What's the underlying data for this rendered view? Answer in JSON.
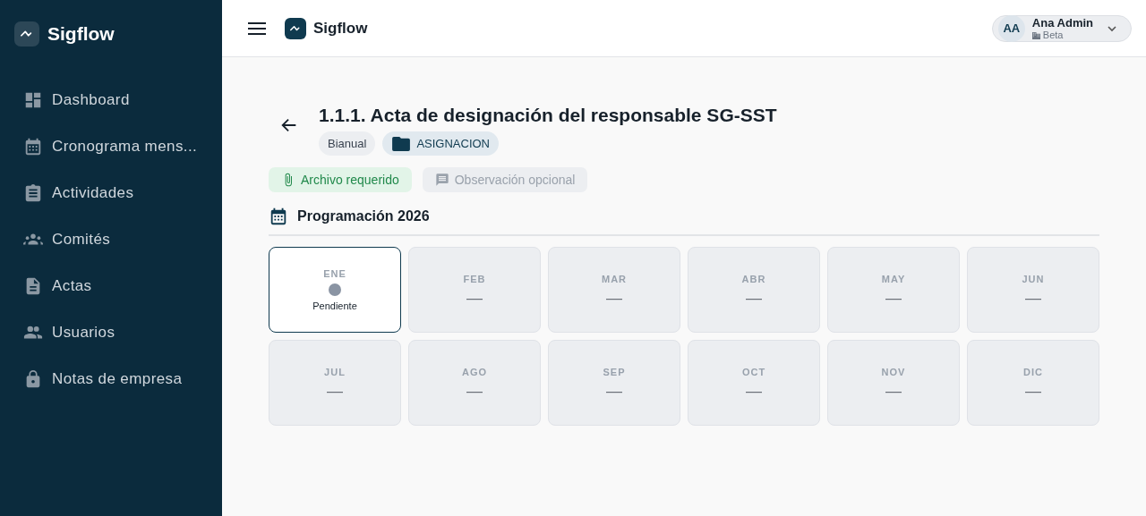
{
  "sidebar": {
    "brand": "Sigflow",
    "items": [
      {
        "label": "Dashboard"
      },
      {
        "label": "Cronograma mens..."
      },
      {
        "label": "Actividades"
      },
      {
        "label": "Comités"
      },
      {
        "label": "Actas"
      },
      {
        "label": "Usuarios"
      },
      {
        "label": "Notas de empresa"
      }
    ]
  },
  "topbar": {
    "brand": "Sigflow",
    "user": {
      "initials": "AA",
      "name": "Ana Admin",
      "org": "Beta"
    }
  },
  "header": {
    "title": "1.1.1. Acta de designación del responsable SG-SST",
    "tags": [
      {
        "label": "Bianual",
        "kind": "plain"
      },
      {
        "label": "ASIGNACION",
        "kind": "folder"
      }
    ]
  },
  "requirements": [
    {
      "label": "Archivo requerido",
      "on": true
    },
    {
      "label": "Observación opcional",
      "on": false
    }
  ],
  "schedule": {
    "title": "Programación 2026",
    "months": [
      {
        "label": "ENE",
        "kind": "status",
        "status": "Pendiente",
        "color": "#8a94a3"
      },
      {
        "label": "FEB",
        "kind": "empty",
        "value": "—"
      },
      {
        "label": "MAR",
        "kind": "empty",
        "value": "—"
      },
      {
        "label": "ABR",
        "kind": "empty",
        "value": "—"
      },
      {
        "label": "MAY",
        "kind": "empty",
        "value": "—"
      },
      {
        "label": "JUN",
        "kind": "empty",
        "value": "—"
      },
      {
        "label": "JUL",
        "kind": "empty",
        "value": "—"
      },
      {
        "label": "AGO",
        "kind": "empty",
        "value": "—"
      },
      {
        "label": "SEP",
        "kind": "empty",
        "value": "—"
      },
      {
        "label": "OCT",
        "kind": "empty",
        "value": "—"
      },
      {
        "label": "NOV",
        "kind": "empty",
        "value": "—"
      },
      {
        "label": "DIC",
        "kind": "empty",
        "value": "—"
      }
    ]
  }
}
